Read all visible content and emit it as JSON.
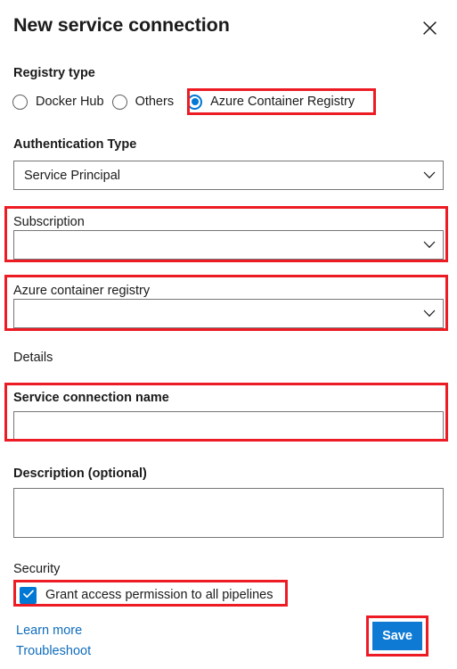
{
  "dialog": {
    "title": "New service connection",
    "close_icon": "close-icon"
  },
  "registry_type": {
    "label": "Registry type",
    "options": [
      {
        "label": "Docker Hub",
        "selected": false
      },
      {
        "label": "Others",
        "selected": false
      },
      {
        "label": "Azure Container Registry",
        "selected": true
      }
    ]
  },
  "authentication_type": {
    "label": "Authentication Type",
    "value": "Service Principal",
    "chevron_icon": "chevron-down-icon"
  },
  "subscription": {
    "label": "Subscription",
    "value": "",
    "chevron_icon": "chevron-down-icon"
  },
  "azure_container_registry": {
    "label": "Azure container registry",
    "value": "",
    "chevron_icon": "chevron-down-icon"
  },
  "details": {
    "label": "Details",
    "service_connection_name": {
      "label": "Service connection name",
      "value": ""
    },
    "description": {
      "label": "Description (optional)",
      "value": ""
    }
  },
  "security": {
    "label": "Security",
    "grant_access": {
      "label": "Grant access permission to all pipelines",
      "checked": true,
      "check_icon": "checkmark-icon"
    }
  },
  "footer": {
    "learn_more": "Learn more",
    "troubleshoot": "Troubleshoot",
    "save_label": "Save"
  },
  "colors": {
    "accent": "#0078d4",
    "save_button": "#0f7ad4",
    "link": "#0f6cbd",
    "highlight": "#ed1c24",
    "text": "#1b1b1b",
    "border": "#767676"
  }
}
